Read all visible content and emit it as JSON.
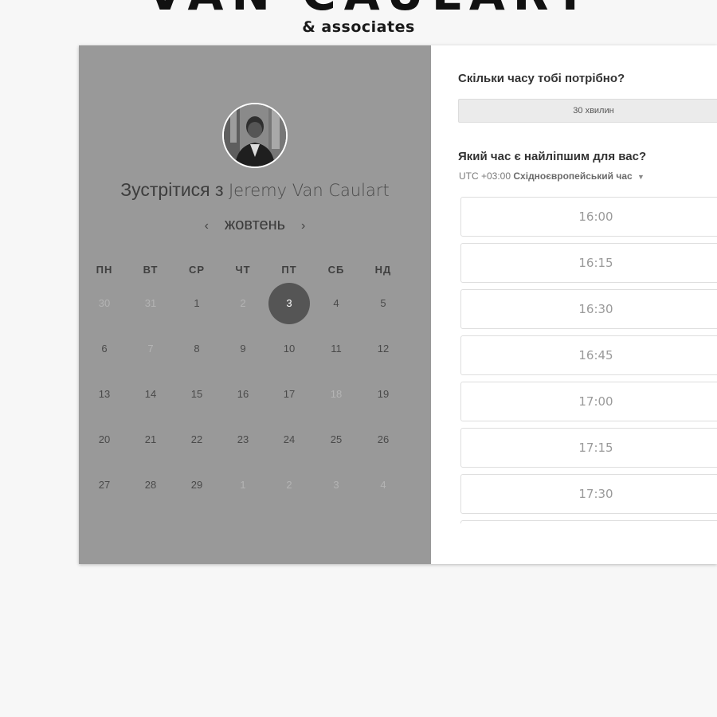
{
  "brand": {
    "name": "VAN CAULART",
    "sub": "& associates"
  },
  "left": {
    "title_prefix": "Зустрітися з",
    "host": "Jeremy Van Caulart",
    "month": "жовтень",
    "prev": "‹",
    "next": "›",
    "weekdays": [
      "ПН",
      "ВТ",
      "СР",
      "ЧТ",
      "ПТ",
      "СБ",
      "НД"
    ],
    "weeks": [
      [
        {
          "d": "30",
          "m": true
        },
        {
          "d": "31",
          "m": true
        },
        {
          "d": "1"
        },
        {
          "d": "2",
          "m": true
        },
        {
          "d": "3",
          "s": true
        },
        {
          "d": "4"
        },
        {
          "d": "5"
        }
      ],
      [
        {
          "d": "6"
        },
        {
          "d": "7",
          "m": true
        },
        {
          "d": "8"
        },
        {
          "d": "9"
        },
        {
          "d": "10"
        },
        {
          "d": "11"
        },
        {
          "d": "12"
        }
      ],
      [
        {
          "d": "13"
        },
        {
          "d": "14"
        },
        {
          "d": "15"
        },
        {
          "d": "16"
        },
        {
          "d": "17"
        },
        {
          "d": "18",
          "m": true
        },
        {
          "d": "19"
        }
      ],
      [
        {
          "d": "20"
        },
        {
          "d": "21"
        },
        {
          "d": "22"
        },
        {
          "d": "23"
        },
        {
          "d": "24"
        },
        {
          "d": "25"
        },
        {
          "d": "26"
        }
      ],
      [
        {
          "d": "27"
        },
        {
          "d": "28"
        },
        {
          "d": "29"
        },
        {
          "d": "1",
          "m": true
        },
        {
          "d": "2",
          "m": true
        },
        {
          "d": "3",
          "m": true
        },
        {
          "d": "4",
          "m": true
        }
      ]
    ]
  },
  "right": {
    "q_duration": "Скільки часу тобі потрібно?",
    "duration": "30 хвилин",
    "q_time": "Який час є найліпшим для вас?",
    "tz_offset": "UTC +03:00",
    "tz_name": "Східноєвропейський час",
    "slots": [
      "16:00",
      "16:15",
      "16:30",
      "16:45",
      "17:00",
      "17:15",
      "17:30",
      ""
    ]
  },
  "colors": {
    "page_bg": "#f7f7f7",
    "left_panel": "#999999",
    "selected_day": "#555555",
    "right_panel": "#ffffff"
  },
  "icons": {
    "prev": "chevron-left-icon",
    "next": "chevron-right-icon",
    "tz": "caret-down-icon"
  }
}
